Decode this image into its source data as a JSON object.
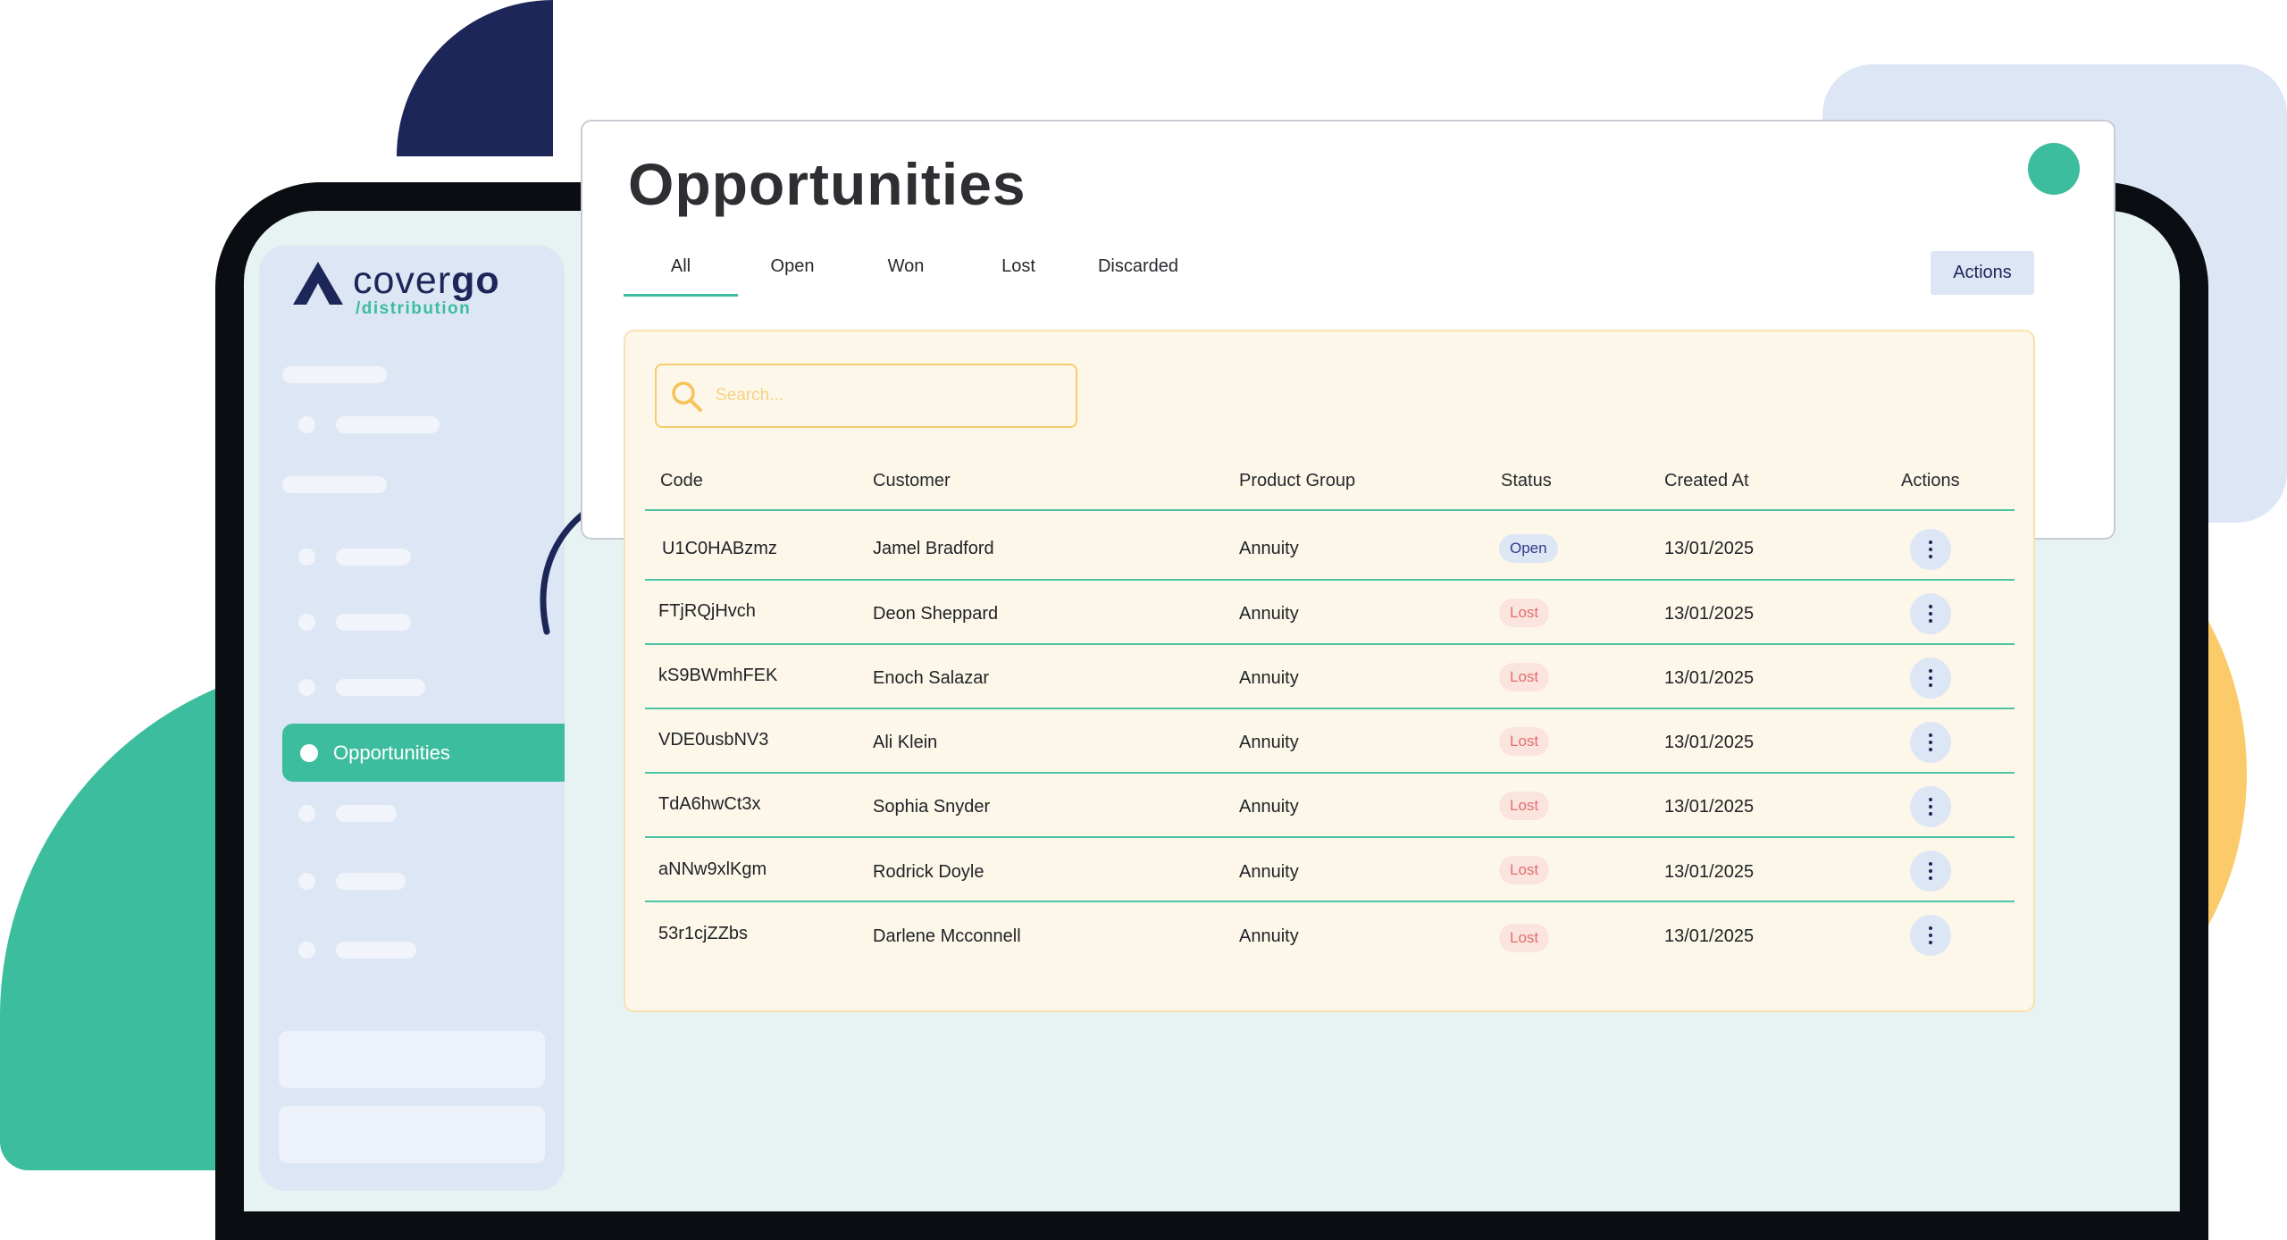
{
  "brand": {
    "name_light": "cover",
    "name_bold": "go",
    "subtitle": "/distribution"
  },
  "sidebar": {
    "active_item": "Opportunities"
  },
  "page": {
    "title": "Opportunities"
  },
  "tabs": [
    "All",
    "Open",
    "Won",
    "Lost",
    "Discarded"
  ],
  "active_tab": "All",
  "toolbar": {
    "actions_label": "Actions"
  },
  "search": {
    "placeholder": "Search..."
  },
  "table": {
    "columns": [
      "Code",
      "Customer",
      "Product Group",
      "Status",
      "Created At",
      "Actions"
    ],
    "rows": [
      {
        "code": "U1C0HABzmz",
        "customer": "Jamel Bradford",
        "product_group": "Annuity",
        "status": "Open",
        "created_at": "13/01/2025"
      },
      {
        "code": "FTjRQjHvch",
        "customer": "Deon Sheppard",
        "product_group": "Annuity",
        "status": "Lost",
        "created_at": "13/01/2025"
      },
      {
        "code": "kS9BWmhFEK",
        "customer": "Enoch Salazar",
        "product_group": "Annuity",
        "status": "Lost",
        "created_at": "13/01/2025"
      },
      {
        "code": "VDE0usbNV3",
        "customer": "Ali Klein",
        "product_group": "Annuity",
        "status": "Lost",
        "created_at": "13/01/2025"
      },
      {
        "code": "TdA6hwCt3x",
        "customer": "Sophia Snyder",
        "product_group": "Annuity",
        "status": "Lost",
        "created_at": "13/01/2025"
      },
      {
        "code": "aNNw9xlKgm",
        "customer": "Rodrick Doyle",
        "product_group": "Annuity",
        "status": "Lost",
        "created_at": "13/01/2025"
      },
      {
        "code": "53r1cjZZbs",
        "customer": "Darlene Mcconnell",
        "product_group": "Annuity",
        "status": "Lost",
        "created_at": "13/01/2025"
      }
    ]
  },
  "colors": {
    "brand_navy": "#1d2658",
    "brand_green": "#3cbd9d",
    "accent_yellow": "#fbcb6a",
    "status_open": "#2e3c8a",
    "status_lost": "#e07070"
  },
  "icons": {
    "search": "search-icon",
    "row_menu": "kebab-menu-icon",
    "logo": "covergo-logo-icon",
    "arrow": "curved-arrow-icon"
  }
}
